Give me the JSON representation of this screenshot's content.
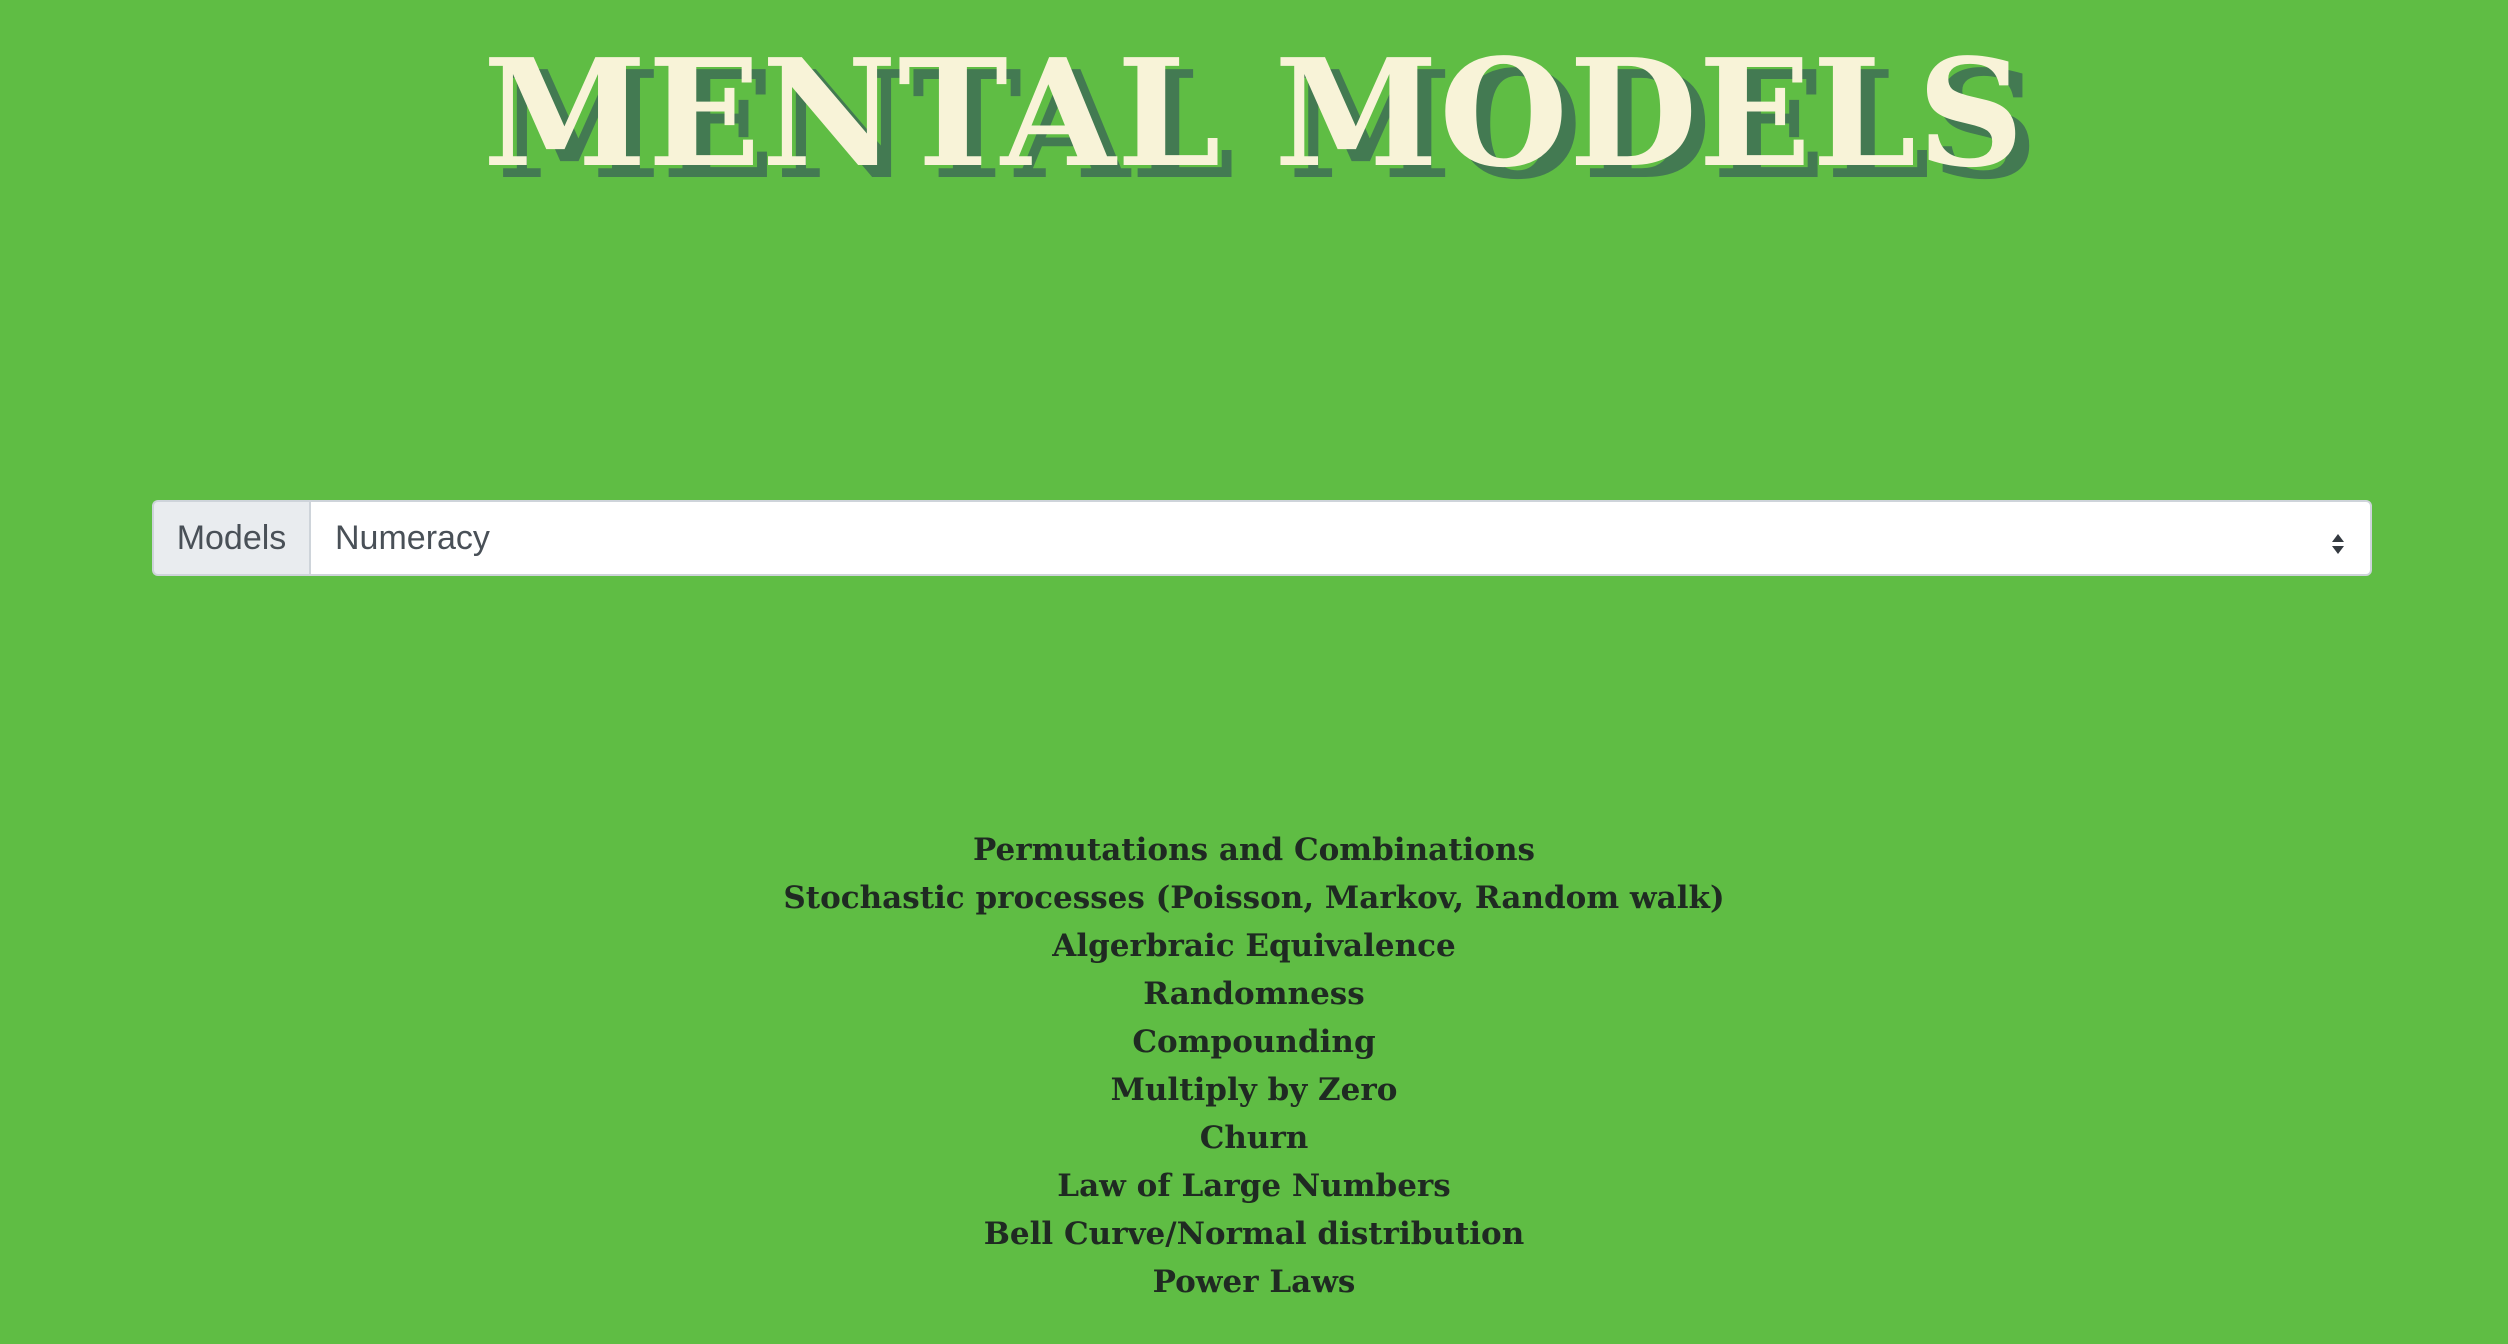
{
  "page": {
    "title": "MENTAL MODELS",
    "background_color": "#5fbd44"
  },
  "selector": {
    "label": "Models",
    "selected_value": "Numeracy",
    "arrow_icon": "select-updown-arrows"
  },
  "models": [
    "Permutations and Combinations",
    "Stochastic processes (Poisson, Markov, Random walk)",
    "Algerbraic Equivalence",
    "Randomness",
    "Compounding",
    "Multiply by Zero",
    "Churn",
    "Law of Large Numbers",
    "Bell Curve/Normal distribution",
    "Power Laws"
  ]
}
